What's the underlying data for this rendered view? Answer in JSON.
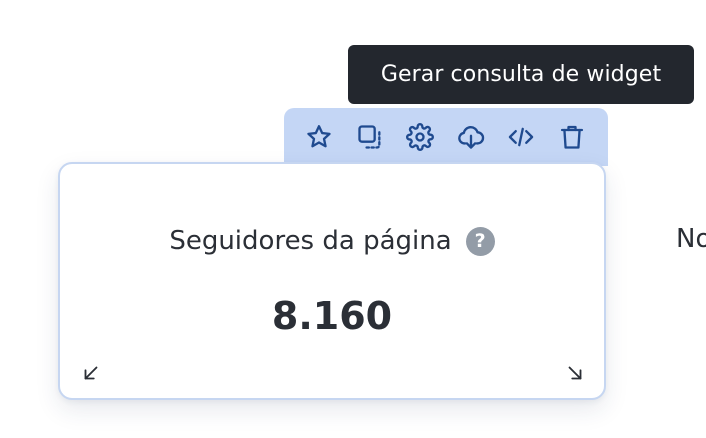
{
  "tooltip": {
    "text": "Gerar consulta de widget"
  },
  "toolbar": {
    "buttons": [
      {
        "icon": "star-icon"
      },
      {
        "icon": "duplicate-icon"
      },
      {
        "icon": "gear-icon"
      },
      {
        "icon": "cloud-download-icon"
      },
      {
        "icon": "code-icon"
      },
      {
        "icon": "trash-icon"
      }
    ]
  },
  "widget": {
    "title": "Seguidores da página",
    "help_glyph": "?",
    "value": "8.160"
  },
  "next_widget": {
    "title_fragment": "No"
  },
  "colors": {
    "toolbar_bg": "#c4d6f5",
    "icon_color": "#1f4a8f",
    "tooltip_bg": "#23272e",
    "card_border": "#c6d6f1",
    "text": "#2b2f36",
    "help_icon_bg": "#939ca7"
  }
}
